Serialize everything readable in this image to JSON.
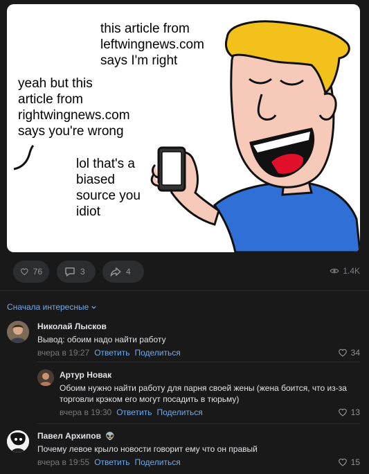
{
  "comic": {
    "bubble1": [
      "this article from",
      "leftwingnews.com",
      "says I'm right"
    ],
    "bubble2": [
      "yeah but this",
      "article from",
      "rightwingnews.com",
      "says you're wrong"
    ],
    "bubble3": [
      "lol that's a",
      "biased",
      "source you",
      "idiot"
    ]
  },
  "actions": {
    "likes": "76",
    "comments": "3",
    "shares": "4",
    "views": "1.4K"
  },
  "sort_label": "Сначала интересные",
  "comments": [
    {
      "author": "Николай Лысков",
      "text": "Вывод: обоим надо найти работу",
      "time": "вчера в 19:27",
      "reply": "Ответить",
      "share": "Поделиться",
      "likes": "34"
    },
    {
      "author": "Артур Новак",
      "text": "Обоим нужно найти работу для парня своей жены (жена боится, что из-за торговли крэком его могут посадить в тюрьму)",
      "time": "вчера в 19:30",
      "reply": "Ответить",
      "share": "Поделиться",
      "likes": "13"
    },
    {
      "author": "Павел Архипов",
      "author_badge": "👽",
      "text": "Почему левое крыло новости говорит ему что он правый",
      "time": "вчера в 19:55",
      "reply": "Ответить",
      "share": "Поделиться",
      "likes": "15"
    }
  ]
}
